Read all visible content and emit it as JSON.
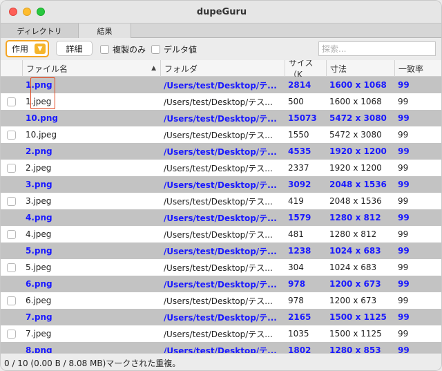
{
  "window": {
    "title": "dupeGuru"
  },
  "tabs": [
    {
      "label": "ディレクトリ"
    },
    {
      "label": "結果"
    }
  ],
  "toolbar": {
    "action_label": "作用",
    "detail_label": "詳細",
    "dupes_only_label": "複製のみ",
    "delta_label": "デルタ値",
    "search_placeholder": "探索..."
  },
  "columns": {
    "name": "ファイル名",
    "folder": "フォルダ",
    "size": "サイズ（K",
    "dimensions": "寸法",
    "match": "一致率"
  },
  "rows": [
    {
      "name": "1.png",
      "folder": "/Users/test/Desktop/テ...",
      "size": "2814",
      "dim": "1600 x 1068",
      "match": "99",
      "ref": true
    },
    {
      "name": "1.jpeg",
      "folder": "/Users/test/Desktop/テス...",
      "size": "500",
      "dim": "1600 x 1068",
      "match": "99",
      "ref": false
    },
    {
      "name": "10.png",
      "folder": "/Users/test/Desktop/テ...",
      "size": "15073",
      "dim": "5472 x 3080",
      "match": "99",
      "ref": true
    },
    {
      "name": "10.jpeg",
      "folder": "/Users/test/Desktop/テス...",
      "size": "1550",
      "dim": "5472 x 3080",
      "match": "99",
      "ref": false
    },
    {
      "name": "2.png",
      "folder": "/Users/test/Desktop/テ...",
      "size": "4535",
      "dim": "1920 x 1200",
      "match": "99",
      "ref": true
    },
    {
      "name": "2.jpeg",
      "folder": "/Users/test/Desktop/テス...",
      "size": "2337",
      "dim": "1920 x 1200",
      "match": "99",
      "ref": false
    },
    {
      "name": "3.png",
      "folder": "/Users/test/Desktop/テ...",
      "size": "3092",
      "dim": "2048 x 1536",
      "match": "99",
      "ref": true
    },
    {
      "name": "3.jpeg",
      "folder": "/Users/test/Desktop/テス...",
      "size": "419",
      "dim": "2048 x 1536",
      "match": "99",
      "ref": false
    },
    {
      "name": "4.png",
      "folder": "/Users/test/Desktop/テ...",
      "size": "1579",
      "dim": "1280 x 812",
      "match": "99",
      "ref": true
    },
    {
      "name": "4.jpeg",
      "folder": "/Users/test/Desktop/テス...",
      "size": "481",
      "dim": "1280 x 812",
      "match": "99",
      "ref": false
    },
    {
      "name": "5.png",
      "folder": "/Users/test/Desktop/テ...",
      "size": "1238",
      "dim": "1024 x 683",
      "match": "99",
      "ref": true
    },
    {
      "name": "5.jpeg",
      "folder": "/Users/test/Desktop/テス...",
      "size": "304",
      "dim": "1024 x 683",
      "match": "99",
      "ref": false
    },
    {
      "name": "6.png",
      "folder": "/Users/test/Desktop/テ...",
      "size": "978",
      "dim": "1200 x 673",
      "match": "99",
      "ref": true
    },
    {
      "name": "6.jpeg",
      "folder": "/Users/test/Desktop/テス...",
      "size": "978",
      "dim": "1200 x 673",
      "match": "99",
      "ref": false
    },
    {
      "name": "7.png",
      "folder": "/Users/test/Desktop/テ...",
      "size": "2165",
      "dim": "1500 x 1125",
      "match": "99",
      "ref": true
    },
    {
      "name": "7.jpeg",
      "folder": "/Users/test/Desktop/テス...",
      "size": "1035",
      "dim": "1500 x 1125",
      "match": "99",
      "ref": false
    },
    {
      "name": "8.png",
      "folder": "/Users/test/Desktop/テ...",
      "size": "1802",
      "dim": "1280 x 853",
      "match": "99",
      "ref": true
    }
  ],
  "status": {
    "text": "0 / 10 (0.00 B / 8.08 MB)マークされた重複。"
  },
  "icons": {
    "sort": "sort-ascending-icon",
    "action_menu": "chevron-down-icon"
  },
  "colors": {
    "reference_text": "#1a1aff",
    "reference_row": "#c3c3c3",
    "accent": "#f5a623",
    "highlight_box": "#e2471f"
  }
}
